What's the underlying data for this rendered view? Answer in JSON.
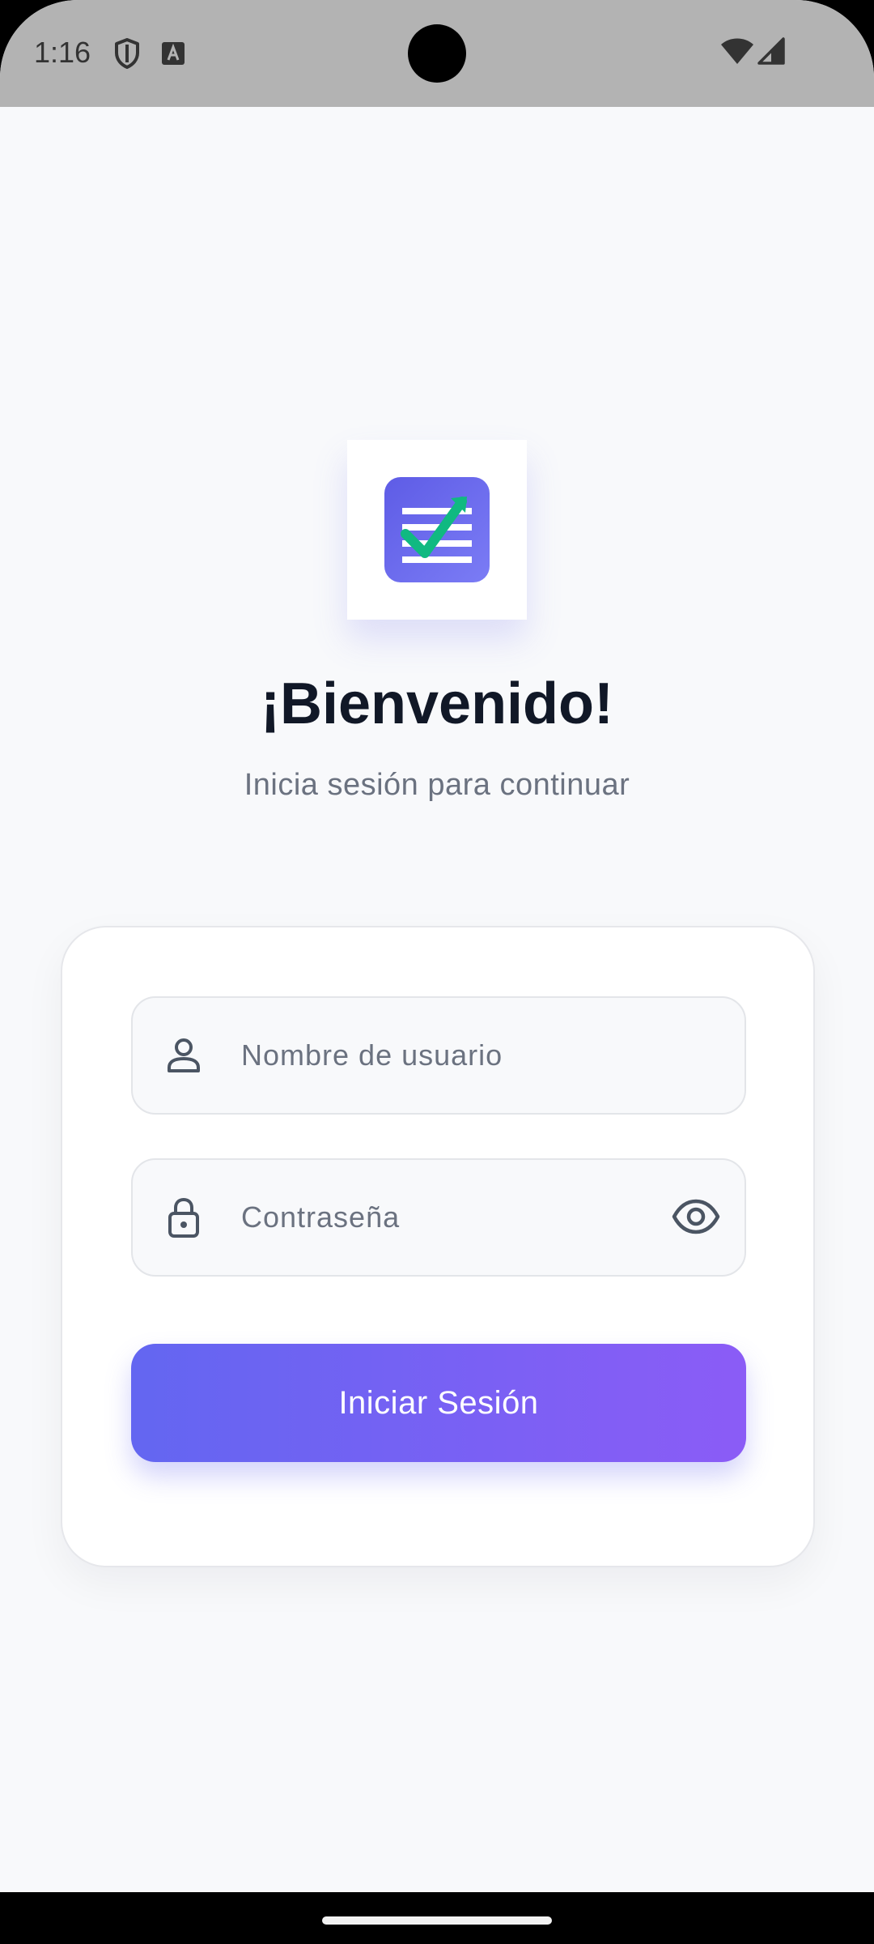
{
  "status_bar": {
    "time": "1:16",
    "icons": [
      "shield-icon",
      "text-a-icon",
      "wifi-icon",
      "signal-icon"
    ]
  },
  "brand": {
    "logo": "task-list-check-icon",
    "accent": "#6366f1",
    "accent_end": "#8b5cf6",
    "check_color": "#10b981"
  },
  "header": {
    "title": "¡Bienvenido!",
    "subtitle": "Inicia sesión para continuar"
  },
  "form": {
    "username": {
      "placeholder": "Nombre de usuario",
      "value": "",
      "icon": "user-icon"
    },
    "password": {
      "placeholder": "Contraseña",
      "value": "",
      "icon": "lock-icon",
      "toggle_icon": "eye-icon"
    },
    "submit_label": "Iniciar Sesión"
  }
}
